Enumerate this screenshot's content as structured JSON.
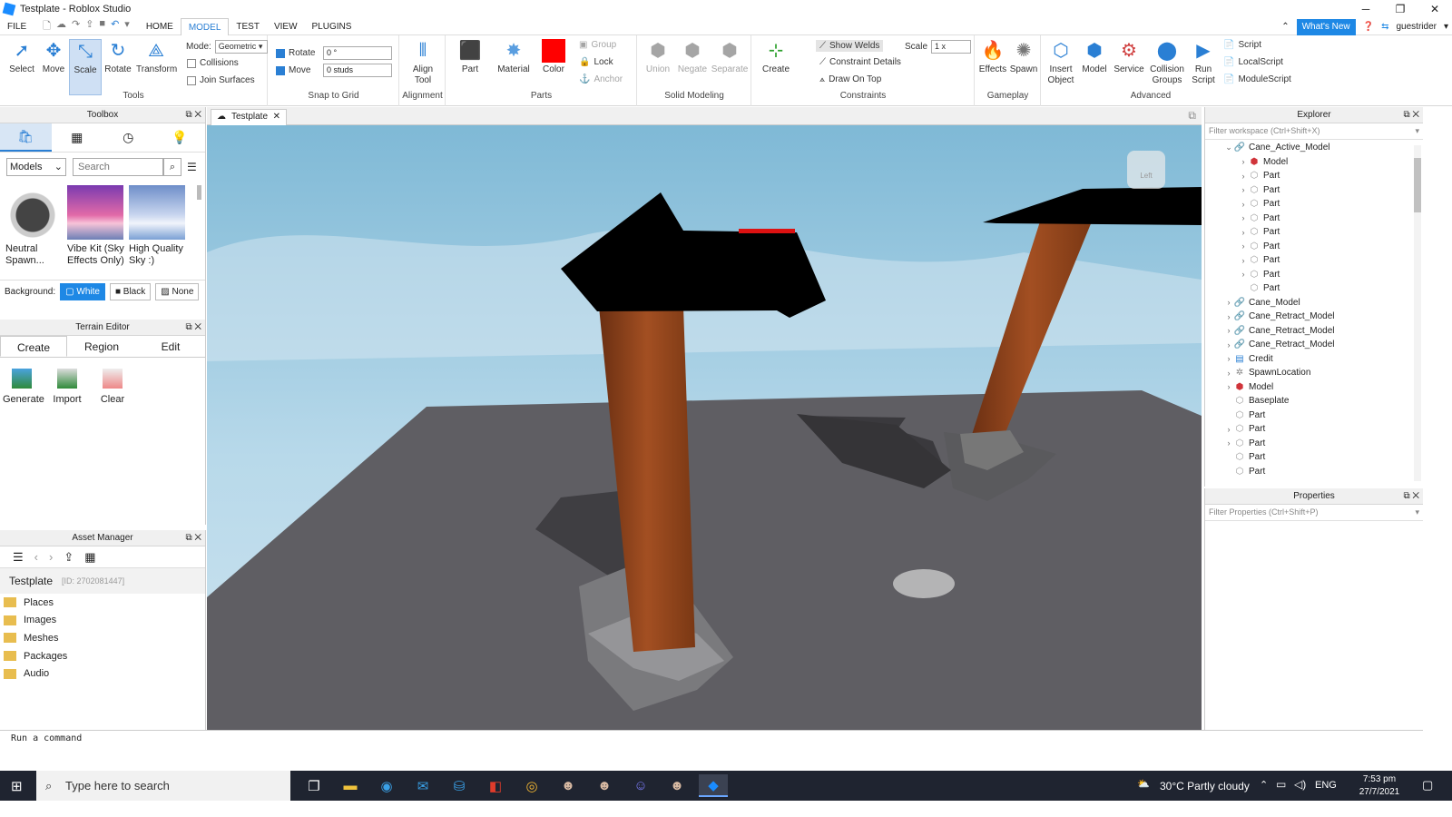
{
  "window": {
    "title": "Testplate - Roblox Studio",
    "user": "guestrider",
    "whats_new": "What's New"
  },
  "menu": [
    "FILE",
    "HOME",
    "MODEL",
    "TEST",
    "VIEW",
    "PLUGINS"
  ],
  "ribbon": {
    "tools": {
      "title": "Tools",
      "items": [
        "Select",
        "Move",
        "Scale",
        "Rotate",
        "Transform"
      ],
      "mode_label": "Mode:",
      "mode_value": "Geometric",
      "collisions": "Collisions",
      "join_surfaces": "Join Surfaces"
    },
    "snap": {
      "title": "Snap to Grid",
      "rotate_label": "Rotate",
      "rotate_value": "0 °",
      "move_label": "Move",
      "move_value": "0 studs"
    },
    "alignment": {
      "title": "Alignment",
      "tool": "Align Tool"
    },
    "parts": {
      "title": "Parts",
      "part": "Part",
      "material": "Material",
      "color": "Color",
      "color_hex": "#ff0000",
      "group": "Group",
      "lock": "Lock",
      "anchor": "Anchor"
    },
    "solid": {
      "title": "Solid Modeling",
      "union": "Union",
      "negate": "Negate",
      "separate": "Separate"
    },
    "constraints": {
      "title": "Constraints",
      "create": "Create",
      "show_welds": "Show Welds",
      "constraint_details": "Constraint Details",
      "draw_on_top": "Draw On Top",
      "scale_label": "Scale",
      "scale_value": "1 x"
    },
    "gameplay": {
      "title": "Gameplay",
      "effects": "Effects",
      "spawn": "Spawn"
    },
    "advanced": {
      "title": "Advanced",
      "insert_object": "Insert Object",
      "model": "Model",
      "service": "Service",
      "collision_groups": "Collision Groups",
      "run_script": "Run Script",
      "script": "Script",
      "local_script": "LocalScript",
      "module_script": "ModuleScript"
    }
  },
  "toolbox": {
    "title": "Toolbox",
    "category": "Models",
    "search_placeholder": "Search",
    "items": [
      {
        "label": "Neutral Spawn..."
      },
      {
        "label": "Vibe Kit (Sky Effects Only)"
      },
      {
        "label": "High Quality Sky :)"
      }
    ],
    "background_label": "Background:",
    "bg_options": [
      "White",
      "Black",
      "None"
    ]
  },
  "terrain": {
    "title": "Terrain Editor",
    "tabs": [
      "Create",
      "Region",
      "Edit"
    ],
    "tools": [
      "Generate",
      "Import",
      "Clear"
    ]
  },
  "assets": {
    "title": "Asset Manager",
    "place": "Testplate",
    "place_id": "[ID: 2702081447]",
    "folders": [
      "Places",
      "Images",
      "Meshes",
      "Packages",
      "Audio"
    ]
  },
  "viewport": {
    "tab": "Testplate",
    "view_cube_label": "Left"
  },
  "explorer": {
    "title": "Explorer",
    "filter_placeholder": "Filter workspace (Ctrl+Shift+X)",
    "items": [
      {
        "label": "Cane_Active_Model",
        "icon": "model-icon",
        "depth": 0,
        "expand": "open"
      },
      {
        "label": "Model",
        "icon": "model-red-icon",
        "depth": 1,
        "expand": "closed"
      },
      {
        "label": "Part",
        "icon": "part-icon",
        "depth": 1,
        "expand": "closed"
      },
      {
        "label": "Part",
        "icon": "part-icon",
        "depth": 1,
        "expand": "closed"
      },
      {
        "label": "Part",
        "icon": "part-icon",
        "depth": 1,
        "expand": "closed"
      },
      {
        "label": "Part",
        "icon": "part-icon",
        "depth": 1,
        "expand": "closed"
      },
      {
        "label": "Part",
        "icon": "part-icon",
        "depth": 1,
        "expand": "closed"
      },
      {
        "label": "Part",
        "icon": "part-icon",
        "depth": 1,
        "expand": "closed"
      },
      {
        "label": "Part",
        "icon": "part-icon",
        "depth": 1,
        "expand": "closed"
      },
      {
        "label": "Part",
        "icon": "part-icon",
        "depth": 1,
        "expand": "closed"
      },
      {
        "label": "Part",
        "icon": "part-icon",
        "depth": 1,
        "expand": "none"
      },
      {
        "label": "Cane_Model",
        "icon": "model-icon",
        "depth": 0,
        "expand": "closed"
      },
      {
        "label": "Cane_Retract_Model",
        "icon": "model-icon",
        "depth": 0,
        "expand": "closed"
      },
      {
        "label": "Cane_Retract_Model",
        "icon": "model-icon",
        "depth": 0,
        "expand": "closed"
      },
      {
        "label": "Cane_Retract_Model",
        "icon": "model-icon",
        "depth": 0,
        "expand": "closed"
      },
      {
        "label": "Credit",
        "icon": "script-icon",
        "depth": 0,
        "expand": "closed"
      },
      {
        "label": "SpawnLocation",
        "icon": "spawn-icon",
        "depth": 0,
        "expand": "closed"
      },
      {
        "label": "Model",
        "icon": "model-red-icon",
        "depth": 0,
        "expand": "closed"
      },
      {
        "label": "Baseplate",
        "icon": "part-icon",
        "depth": 0,
        "expand": "none"
      },
      {
        "label": "Part",
        "icon": "part-icon",
        "depth": 0,
        "expand": "none"
      },
      {
        "label": "Part",
        "icon": "part-icon",
        "depth": 0,
        "expand": "closed"
      },
      {
        "label": "Part",
        "icon": "part-icon",
        "depth": 0,
        "expand": "closed"
      },
      {
        "label": "Part",
        "icon": "part-icon",
        "depth": 0,
        "expand": "none"
      },
      {
        "label": "Part",
        "icon": "part-icon",
        "depth": 0,
        "expand": "none"
      }
    ]
  },
  "properties": {
    "title": "Properties",
    "filter_placeholder": "Filter Properties (Ctrl+Shift+P)"
  },
  "command_bar": {
    "placeholder": "Run a command"
  },
  "taskbar": {
    "search": "Type here to search",
    "weather": "30°C  Partly cloudy",
    "lang": "ENG",
    "time": "7:53 pm",
    "date": "27/7/2021"
  }
}
